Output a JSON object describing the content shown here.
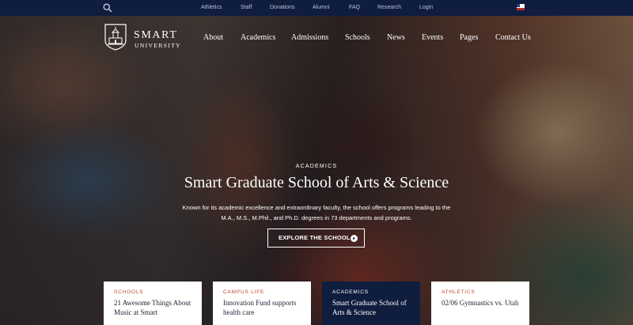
{
  "topbar": {
    "links": [
      "Athletics",
      "Staff",
      "Donations",
      "Alumni",
      "FAQ",
      "Research",
      "Login"
    ]
  },
  "brand": {
    "name": "SMART",
    "subtitle": "UNIVERSITY"
  },
  "nav": {
    "items": [
      "About",
      "Academics",
      "Admissions",
      "Schools",
      "News",
      "Events",
      "Pages",
      "Contact Us"
    ]
  },
  "hero": {
    "eyebrow": "ACADEMICS",
    "title": "Smart Graduate School of Arts & Science",
    "description": "Known for its academic excellence and extraordinary faculty, the school offers programs leading to the M.A., M.S., M.Phil., and Ph.D. degrees in 73 departments and programs.",
    "cta_label": "EXPLORE THE SCHOOL"
  },
  "cards": [
    {
      "category": "SCHOOLS",
      "title": "21 Awesome Things About Music at Smart"
    },
    {
      "category": "CAMPUS LIFE",
      "title": "Innovation Fund supports health care"
    },
    {
      "category": "ACADEMICS",
      "title": "Smart Graduate School of Arts & Science"
    },
    {
      "category": "ATHLETICS",
      "title": "02/06 Gymnastics vs. Utah"
    }
  ],
  "colors": {
    "navy": "#0f1d3e",
    "accent": "#c0492a",
    "text_dark": "#1c2333"
  },
  "icons": {
    "search": "search-icon",
    "flag": "us-flag-icon",
    "logo": "university-building-logo",
    "cta_arrow": "arrow-right-circle-icon"
  }
}
